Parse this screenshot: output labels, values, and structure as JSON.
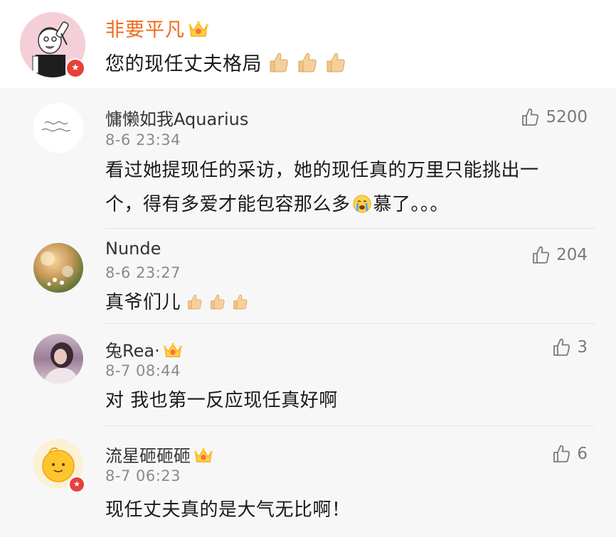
{
  "main_comment": {
    "author": "非要平凡",
    "text": "您的现任丈夫格局",
    "emoji_count": 3,
    "avatar_icon": "cartoon-avatar-icon",
    "badge_icon": "vip-badge-icon"
  },
  "replies": [
    {
      "author": "慵懒如我Aquarius",
      "time": "8-6 23:34",
      "text_line1": "看过她提现任的采访，她的现任真的万里只能挑出一",
      "text_line2_a": "个，得有多爱才能包容那么多",
      "text_line2_b": "慕了。。。",
      "likes": "5200"
    },
    {
      "author": "Nunde",
      "time": "8-6 23:27",
      "text": "真爷们儿",
      "likes": "204"
    },
    {
      "author": "兔Rea·",
      "time": "8-7 08:44",
      "text": "对 我也第一反应现任真好啊",
      "likes": "3"
    },
    {
      "author": "流星砸砸砸",
      "time": "8-7 06:23",
      "text": "现任丈夫真的是大气无比啊！",
      "likes": "6"
    }
  ],
  "colors": {
    "vip_name": "#f26a1b",
    "badge_red": "#e8403b",
    "reply_bg": "#f7f7f7"
  }
}
